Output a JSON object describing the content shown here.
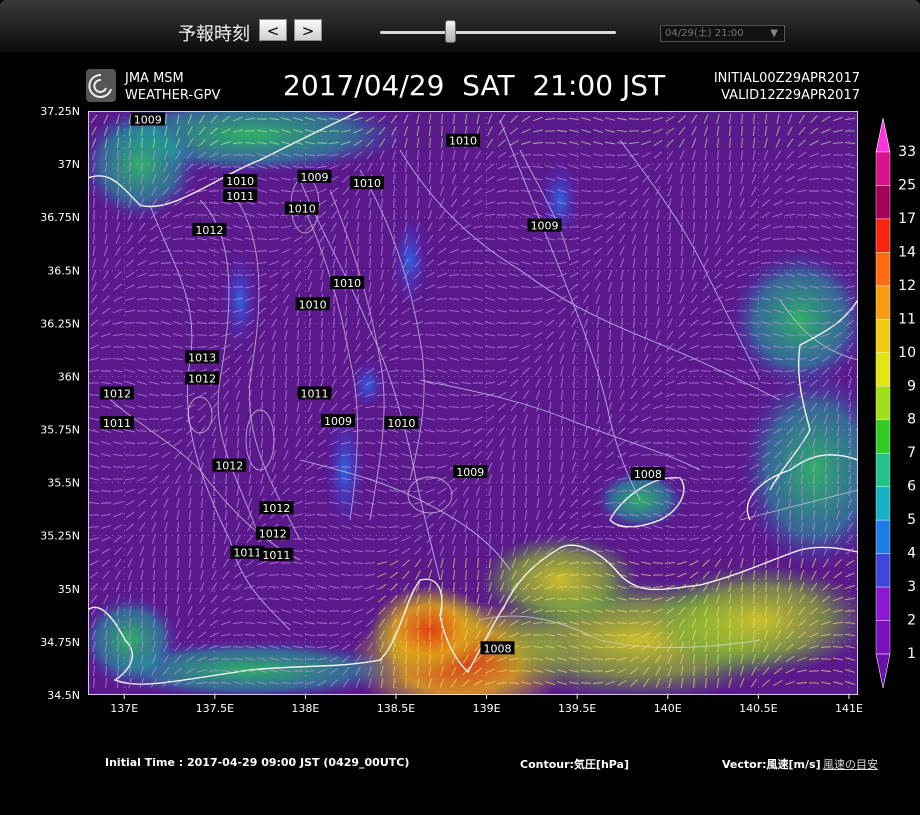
{
  "header": {
    "time_label": "予報時刻",
    "prev_label": "<",
    "next_label": ">",
    "time_select_value": "04/29(土) 21:00",
    "slider_position": 0.3
  },
  "map": {
    "logo_line1": "JMA MSM",
    "logo_line2": "WEATHER-GPV",
    "valid_time": "2017/04/29  SAT  21:00 JST",
    "initial_stamp": "INITIAL00Z29APR2017",
    "valid_stamp": "VALID12Z29APR2017",
    "lat_labels": [
      "37.25N",
      "37N",
      "36.75N",
      "36.5N",
      "36.25N",
      "36N",
      "35.75N",
      "35.5N",
      "35.25N",
      "35N",
      "34.75N",
      "34.5N"
    ],
    "lon_labels": [
      "137E",
      "137.5E",
      "138E",
      "138.5E",
      "139E",
      "139.5E",
      "140E",
      "140.5E",
      "141E"
    ],
    "lat_range": [
      34.5,
      37.25
    ],
    "lon_range": [
      136.8,
      141.05
    ],
    "pressure_labels": [
      {
        "text": "1009",
        "lon": 137.13,
        "lat": 37.21
      },
      {
        "text": "1010",
        "lon": 138.87,
        "lat": 37.11
      },
      {
        "text": "1009",
        "lon": 138.05,
        "lat": 36.94
      },
      {
        "text": "1010",
        "lon": 138.34,
        "lat": 36.91
      },
      {
        "text": "1010",
        "lon": 137.64,
        "lat": 36.92
      },
      {
        "text": "1011",
        "lon": 137.64,
        "lat": 36.85
      },
      {
        "text": "1010",
        "lon": 137.98,
        "lat": 36.79
      },
      {
        "text": "1009",
        "lon": 139.32,
        "lat": 36.71
      },
      {
        "text": "1012",
        "lon": 137.47,
        "lat": 36.69
      },
      {
        "text": "1010",
        "lon": 138.23,
        "lat": 36.44
      },
      {
        "text": "1010",
        "lon": 138.04,
        "lat": 36.34
      },
      {
        "text": "1013",
        "lon": 137.43,
        "lat": 36.09
      },
      {
        "text": "1012",
        "lon": 137.43,
        "lat": 35.99
      },
      {
        "text": "1012",
        "lon": 136.96,
        "lat": 35.92
      },
      {
        "text": "1011",
        "lon": 136.96,
        "lat": 35.78
      },
      {
        "text": "1011",
        "lon": 138.05,
        "lat": 35.92
      },
      {
        "text": "1009",
        "lon": 138.18,
        "lat": 35.79
      },
      {
        "text": "1010",
        "lon": 138.53,
        "lat": 35.78
      },
      {
        "text": "1009",
        "lon": 138.91,
        "lat": 35.55
      },
      {
        "text": "1008",
        "lon": 139.89,
        "lat": 35.54
      },
      {
        "text": "1012",
        "lon": 137.58,
        "lat": 35.58
      },
      {
        "text": "1012",
        "lon": 137.84,
        "lat": 35.38
      },
      {
        "text": "1012",
        "lon": 137.82,
        "lat": 35.26
      },
      {
        "text": "1011",
        "lon": 137.68,
        "lat": 35.17
      },
      {
        "text": "1011",
        "lon": 137.84,
        "lat": 35.16
      },
      {
        "text": "1008",
        "lon": 139.06,
        "lat": 34.72
      }
    ]
  },
  "colorbar": {
    "ticks": [
      "33",
      "25",
      "17",
      "14",
      "12",
      "11",
      "10",
      "9",
      "8",
      "7",
      "6",
      "5",
      "4",
      "3",
      "2",
      "1"
    ],
    "colors": [
      "#ff33dd",
      "#d8128c",
      "#a30055",
      "#f52410",
      "#fd6a10",
      "#f89d10",
      "#f0cc12",
      "#e4e414",
      "#a0dd1a",
      "#33cc22",
      "#22c28a",
      "#16b2c2",
      "#1c7ce8",
      "#3c46dc",
      "#8c18d4",
      "#7a0fbc",
      "#6a12a8"
    ]
  },
  "footer": {
    "initial_time": "Initial Time : 2017-04-29 09:00 JST (0429_00UTC)",
    "contour": "Contour:気圧[hPa]",
    "vector": "Vector:風速[m/s]",
    "guide_link": "風速の目安"
  }
}
